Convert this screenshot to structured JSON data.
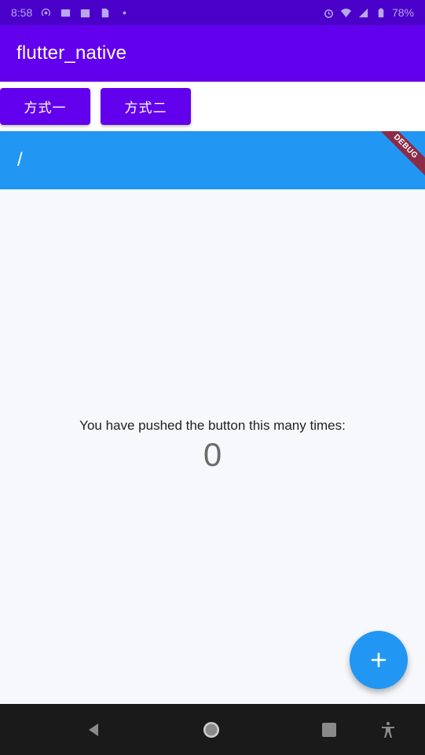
{
  "status_bar": {
    "time": "8:58",
    "battery": "78%",
    "left_icons": [
      "hotspot-icon",
      "news-icon",
      "calendar-icon",
      "sim-icon",
      "dot-icon"
    ],
    "right_icons": [
      "alarm-icon",
      "wifi-icon",
      "signal-icon",
      "battery-icon"
    ]
  },
  "app_bar": {
    "title": "flutter_native"
  },
  "buttons": {
    "mode_one": "方式一",
    "mode_two": "方式二"
  },
  "route_bar": {
    "title": "/",
    "debug_label": "DEBUG"
  },
  "counter": {
    "label": "You have pushed the button this many times:",
    "value": "0"
  },
  "fab": {
    "icon": "add-icon"
  },
  "nav_bar": {
    "icons": [
      "back-icon",
      "home-icon",
      "recents-icon",
      "accessibility-icon"
    ]
  },
  "colors": {
    "status_bar": "#4a00c8",
    "primary": "#6200ee",
    "flutter_primary": "#2196f3",
    "debug_banner": "#8b2c46",
    "nav_bar": "#1a1a1a"
  }
}
